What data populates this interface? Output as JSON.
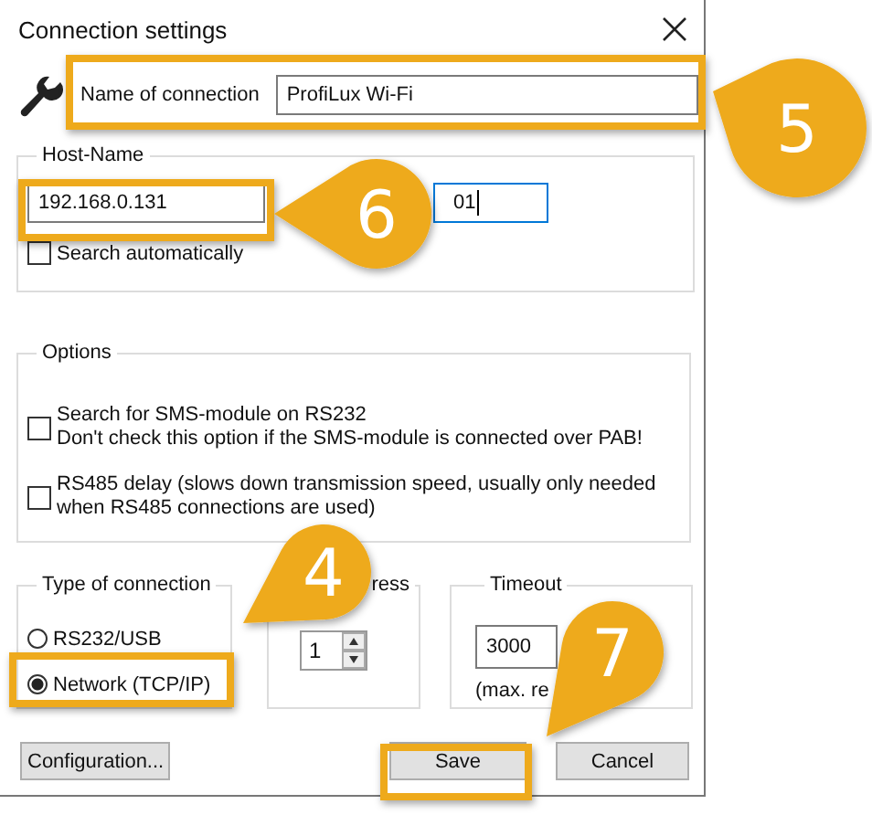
{
  "window": {
    "title": "Connection settings"
  },
  "name_of_connection": {
    "label": "Name of connection",
    "value": "ProfiLux Wi-Fi"
  },
  "host_name": {
    "title": "Host-Name",
    "address": "192.168.0.131",
    "field_2": "01",
    "search_automatically": {
      "label": "Search automatically",
      "checked": false
    }
  },
  "options": {
    "title": "Options",
    "items": [
      {
        "lines": [
          "Search for SMS-module on RS232",
          "Don't check this option if the SMS-module is connected over PAB!"
        ],
        "checked": false
      },
      {
        "lines": [
          "RS485 delay (slows down transmission speed, usually only needed",
          "when RS485 connections are used)"
        ],
        "checked": false
      }
    ]
  },
  "type_of_connection": {
    "title": "Type of connection",
    "options": [
      {
        "label": "RS232/USB",
        "selected": false
      },
      {
        "label": "Network (TCP/IP)",
        "selected": true
      }
    ]
  },
  "group_2": {
    "title": "ress",
    "value": "1"
  },
  "timeout": {
    "title": "Timeout",
    "value": "3000",
    "note": "(max. re"
  },
  "buttons": [
    {
      "label": "Configuration..."
    },
    {
      "label": "Save"
    },
    {
      "label": "Cancel"
    }
  ],
  "callouts": [
    {
      "number": "5"
    },
    {
      "number": "6"
    },
    {
      "number": "4"
    },
    {
      "number": "7"
    }
  ]
}
